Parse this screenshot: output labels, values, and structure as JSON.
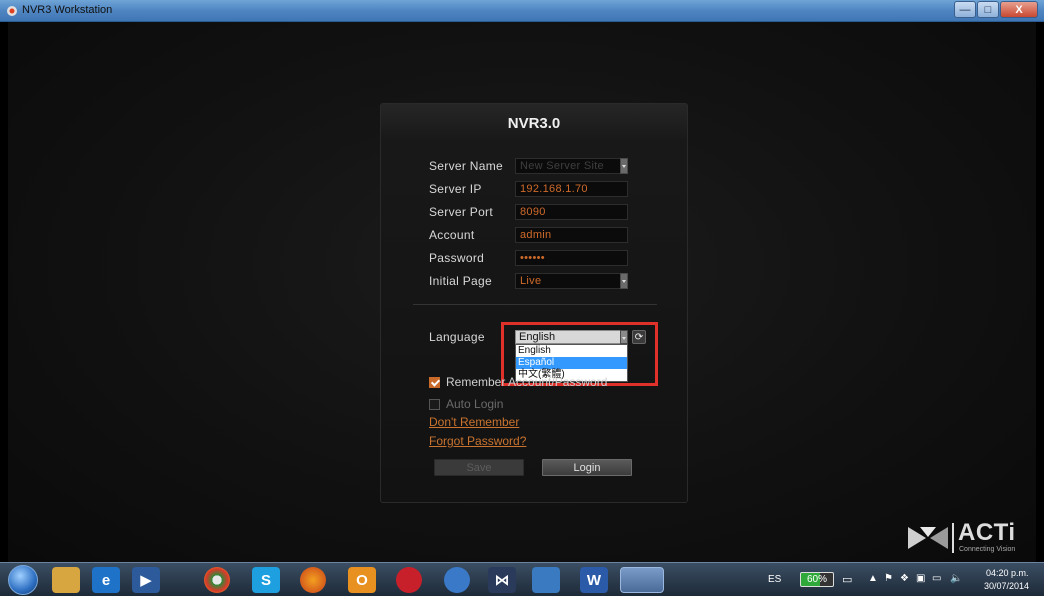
{
  "window": {
    "title": "NVR3 Workstation",
    "minimize": "—",
    "maximize": "□",
    "close": "X"
  },
  "login": {
    "heading": "NVR3.0",
    "fields": {
      "server_name_label": "Server Name",
      "server_name_placeholder": "New Server Site",
      "server_ip_label": "Server IP",
      "server_ip_value": "192.168.1.70",
      "server_port_label": "Server Port",
      "server_port_value": "8090",
      "account_label": "Account",
      "account_value": "admin",
      "password_label": "Password",
      "password_value": "••••••",
      "initial_page_label": "Initial Page",
      "initial_page_value": "Live"
    },
    "language": {
      "label": "Language",
      "selected": "English",
      "options": [
        "English",
        "Español",
        "中文(繁體)"
      ],
      "highlighted_index": 1
    },
    "remember_label": "Remember Account/Password",
    "remember_checked": true,
    "auto_login_label": "Auto Login",
    "auto_login_checked": false,
    "dont_remember_link": "Don't Remember",
    "forgot_password_link": "Forgot Password?",
    "save_button": "Save",
    "login_button": "Login",
    "refresh_icon": "refresh-icon"
  },
  "brand": {
    "logo_text": "ACTi",
    "logo_tagline": "Connecting Vision"
  },
  "taskbar": {
    "language": "ES",
    "battery": "60%",
    "time": "04:20 p.m.",
    "date": "30/07/2014"
  },
  "colors": {
    "accent_orange": "#cf6a2a",
    "highlight_box": "#e0302a",
    "list_highlight": "#3399ff"
  }
}
